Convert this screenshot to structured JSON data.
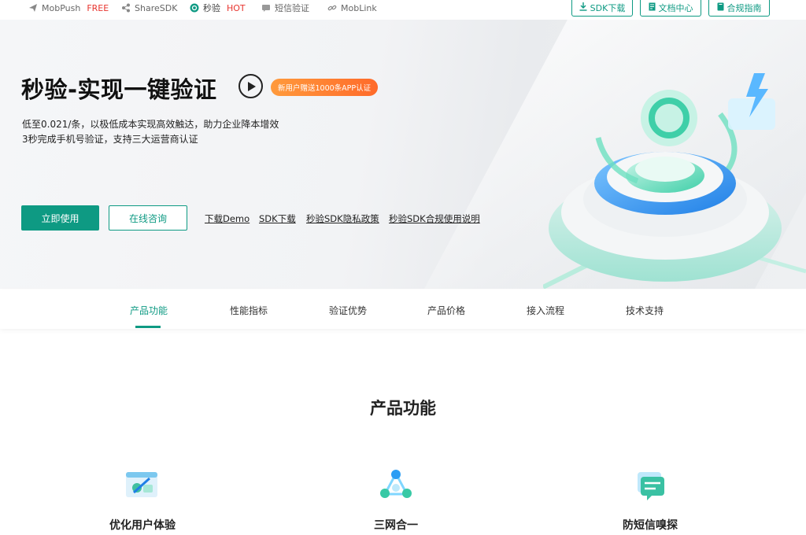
{
  "topbar": {
    "products": [
      {
        "label": "MobPush",
        "tag": "FREE",
        "icon": "paper-plane-icon"
      },
      {
        "label": "ShareSDK",
        "tag": "",
        "icon": "share-icon"
      },
      {
        "label": "秒验",
        "tag": "HOT",
        "icon": "verify-check-icon"
      },
      {
        "label": "短信验证",
        "tag": "",
        "icon": "message-icon"
      },
      {
        "label": "MobLink",
        "tag": "",
        "icon": "link-icon"
      }
    ],
    "buttons": [
      {
        "label": "SDK下载",
        "icon": "download-icon"
      },
      {
        "label": "文档中心",
        "icon": "document-icon"
      },
      {
        "label": "合规指南",
        "icon": "book-icon"
      }
    ]
  },
  "hero": {
    "title": "秒验-实现一键验证",
    "badge": "新用户赠送1000条APP认证",
    "desc_line1": "低至0.021/条，以极低成本实现高效触达，助力企业降本增效",
    "desc_line2": "3秒完成手机号验证，支持三大运营商认证",
    "primary_button": "立即使用",
    "outline_button": "在线咨询",
    "links": [
      "下载Demo",
      "SDK下载",
      "秒验SDK隐私政策",
      "秒验SDK合规使用说明"
    ]
  },
  "tabs": [
    "产品功能",
    "性能指标",
    "验证优势",
    "产品价格",
    "接入流程",
    "技术支持"
  ],
  "active_tab": "产品功能",
  "features": {
    "title": "产品功能",
    "items": [
      {
        "label": "优化用户体验",
        "icon": "user-experience-icon"
      },
      {
        "label": "三网合一",
        "icon": "network-merge-icon"
      },
      {
        "label": "防短信嗅探",
        "icon": "sms-shield-icon"
      }
    ]
  },
  "colors": {
    "accent": "#0e9a83",
    "hot": "#e8342e",
    "badge": "#ff7a2e"
  }
}
